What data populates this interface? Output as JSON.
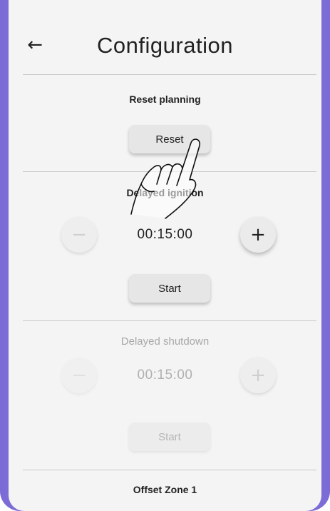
{
  "header": {
    "title": "Configuration",
    "back_icon": "arrow-left-icon"
  },
  "sections": {
    "reset_planning": {
      "title": "Reset planning",
      "button_label": "Reset"
    },
    "delayed_ignition": {
      "title": "Delayed ignition",
      "time_value": "00:15:00",
      "minus_label": "−",
      "plus_label": "+",
      "start_label": "Start"
    },
    "delayed_shutdown": {
      "title": "Delayed shutdown",
      "time_value": "00:15:00",
      "minus_label": "−",
      "plus_label": "+",
      "start_label": "Start"
    },
    "offset_zone_1": {
      "title": "Offset Zone 1"
    }
  },
  "overlay": {
    "icon": "tap-hand-icon"
  },
  "colors": {
    "device_edge": "#7b6bd6",
    "background": "#f4f4f4"
  }
}
